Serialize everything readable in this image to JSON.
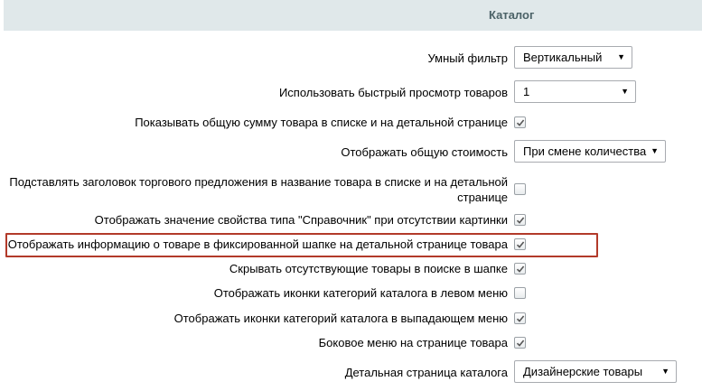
{
  "header": {
    "title": "Каталог"
  },
  "rows": {
    "smart_filter": {
      "label": "Умный фильтр",
      "value": "Вертикальный"
    },
    "quick_view": {
      "label": "Использовать быстрый просмотр товаров",
      "value": "1"
    },
    "total_sum": {
      "label": "Показывать общую сумму товара в списке и на детальной странице",
      "checked": true
    },
    "total_cost": {
      "label": "Отображать общую стоимость",
      "value": "При смене количества"
    },
    "offer_title": {
      "label": "Подставлять заголовок торгового предложения в название товара в списке и на детальной странице",
      "checked": false
    },
    "directory_prop": {
      "label": "Отображать значение свойства типа \"Справочник\" при отсутствии картинки",
      "checked": true
    },
    "fixed_header_info": {
      "label": "Отображать информацию о товаре в фиксированной шапке на детальной странице товара",
      "checked": true
    },
    "hide_missing": {
      "label": "Скрывать отсутствующие товары в поиске в шапке",
      "checked": true
    },
    "left_menu_icons": {
      "label": "Отображать иконки категорий каталога в левом меню",
      "checked": false
    },
    "dropdown_menu_icons": {
      "label": "Отображать иконки категорий каталога в выпадающем меню",
      "checked": true
    },
    "side_menu": {
      "label": "Боковое меню на странице товара",
      "checked": true
    },
    "detail_page": {
      "label": "Детальная страница каталога",
      "value": "Дизайнерские товары"
    }
  }
}
